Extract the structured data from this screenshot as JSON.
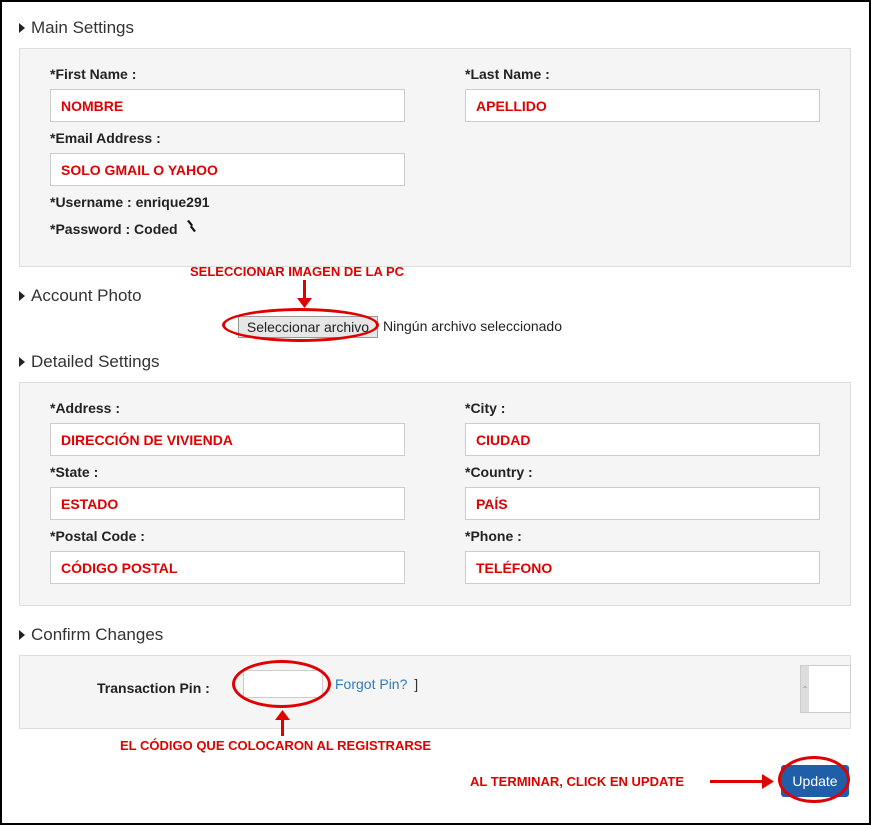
{
  "sections": {
    "main": "Main Settings",
    "photo": "Account Photo",
    "detailed": "Detailed Settings",
    "confirm": "Confirm Changes"
  },
  "main": {
    "first_name_label": "*First Name :",
    "first_name_value": "NOMBRE",
    "last_name_label": "*Last Name :",
    "last_name_value": "APELLIDO",
    "email_label": "*Email Address :",
    "email_value": "SOLO GMAIL O YAHOO",
    "username_text": "*Username : enrique291",
    "password_text": "*Password : Coded"
  },
  "photo": {
    "annotation": "SELECCIONAR IMAGEN DE LA PC",
    "button_label": "Seleccionar archivo",
    "status": "Ningún archivo seleccionado"
  },
  "detailed": {
    "address_label": "*Address :",
    "address_value": "DIRECCIÓN DE VIVIENDA",
    "city_label": "*City :",
    "city_value": "CIUDAD",
    "state_label": "*State :",
    "state_value": "ESTADO",
    "country_label": "*Country :",
    "country_value": "PAÍS",
    "postal_label": "*Postal Code :",
    "postal_value": "CÓDIGO POSTAL",
    "phone_label": "*Phone :",
    "phone_value": "TELÉFONO"
  },
  "confirm": {
    "pin_label": "Transaction Pin :",
    "forgot_label": "Forgot Pin?",
    "forgot_close": "]",
    "pin_annotation": "EL CÓDIGO QUE COLOCARON AL REGISTRARSE",
    "update_annotation": "AL TERMINAR, CLICK EN UPDATE",
    "update_label": "Update"
  },
  "colors": {
    "annotation_red": "#e00000",
    "button_blue": "#1f5ea8",
    "link_blue": "#337ab7"
  }
}
